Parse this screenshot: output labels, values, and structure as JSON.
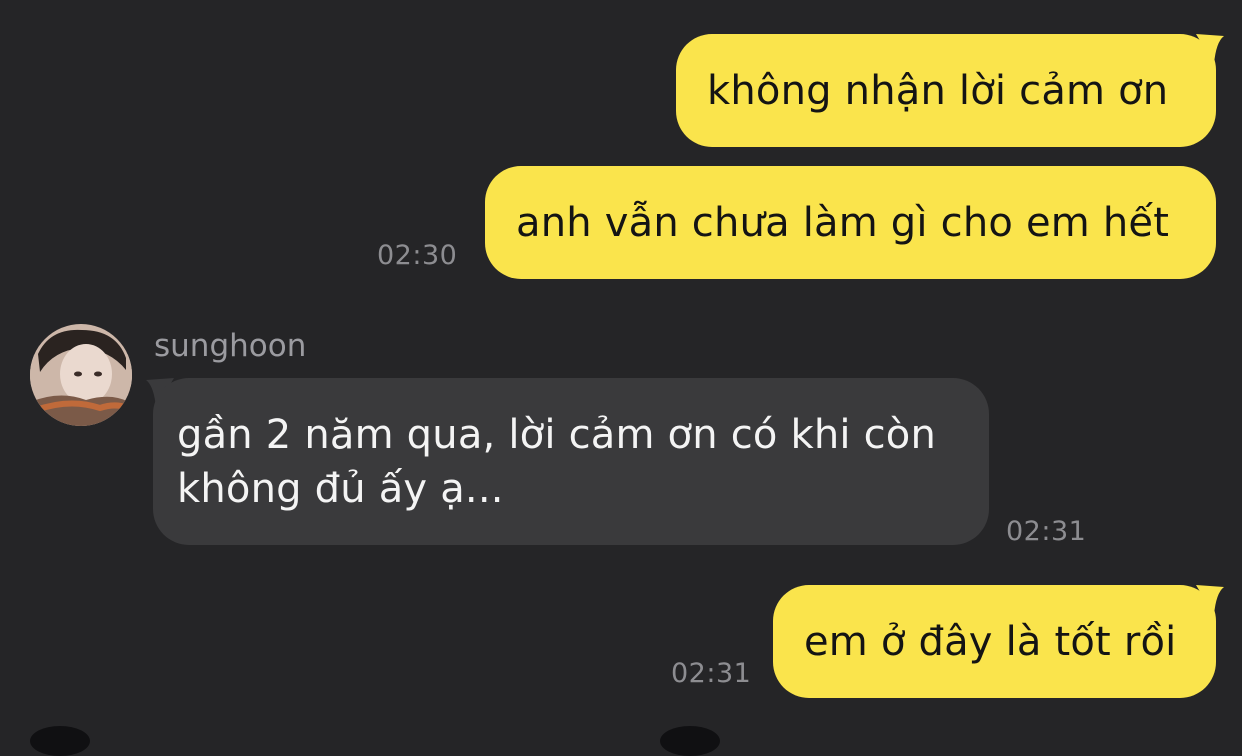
{
  "messages": [
    {
      "type": "sent",
      "text": "không nhận lời cảm ơn",
      "time": ""
    },
    {
      "type": "sent",
      "text": "anh vẫn chưa làm gì cho em hết",
      "time": "02:30"
    },
    {
      "type": "received",
      "sender": "sunghoon",
      "text": "gần 2 năm qua, lời cảm ơn có khi còn không đủ ấy ạ...",
      "time": "02:31"
    },
    {
      "type": "sent",
      "text": "em ở đây là tốt rồi",
      "time": "02:31"
    }
  ],
  "colors": {
    "background": "#252527",
    "sent_bubble": "#fae44c",
    "received_bubble": "#3a3a3c",
    "timestamp": "#8d8d91"
  }
}
